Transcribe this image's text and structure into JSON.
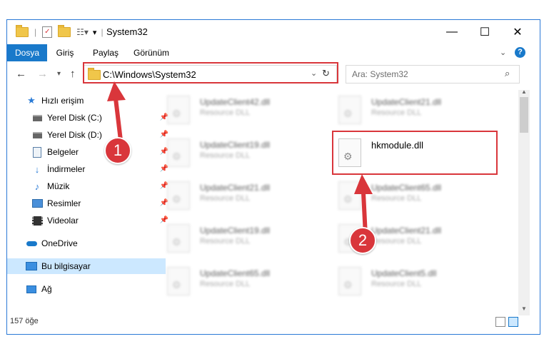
{
  "window": {
    "title": "System32"
  },
  "ribbon": {
    "tabs": [
      "Dosya",
      "Giriş",
      "Paylaş",
      "Görünüm"
    ],
    "help": "?"
  },
  "address": {
    "path": "C:\\Windows\\System32"
  },
  "search": {
    "placeholder": "Ara: System32"
  },
  "nav": {
    "items": [
      {
        "label": "Hızlı erişim",
        "icon": "star-icon"
      },
      {
        "label": "Yerel Disk (C:)",
        "icon": "drive-icon"
      },
      {
        "label": "Yerel Disk (D:)",
        "icon": "drive-icon"
      },
      {
        "label": "Belgeler",
        "icon": "documents-icon"
      },
      {
        "label": "İndirmeler",
        "icon": "download-icon"
      },
      {
        "label": "Müzik",
        "icon": "music-icon"
      },
      {
        "label": "Resimler",
        "icon": "pictures-icon"
      },
      {
        "label": "Videolar",
        "icon": "video-icon"
      },
      {
        "label": "OneDrive",
        "icon": "cloud-icon"
      },
      {
        "label": "Bu bilgisayar",
        "icon": "computer-icon"
      },
      {
        "label": "Ağ",
        "icon": "network-icon"
      }
    ]
  },
  "files": [
    {
      "name": "UpdateClient42.dll",
      "type": "Resource DLL"
    },
    {
      "name": "UpdateClient21.dll",
      "type": "Resource DLL"
    },
    {
      "name": "UpdateClient19.dll",
      "type": "Resource DLL"
    },
    {
      "name": "hkmodule.dll",
      "type": ""
    },
    {
      "name": "UpdateClient21.dll",
      "type": "Resource DLL"
    },
    {
      "name": "UpdateClient65.dll",
      "type": "Resource DLL"
    },
    {
      "name": "UpdateClient19.dll",
      "type": "Resource DLL"
    },
    {
      "name": "UpdateClient21.dll",
      "type": "Resource DLL"
    },
    {
      "name": "UpdateClient65.dll",
      "type": "Resource DLL"
    },
    {
      "name": "UpdateClient5.dll",
      "type": "Resource DLL"
    }
  ],
  "status": {
    "count": "157 öğe"
  },
  "annotations": {
    "badge1": "1",
    "badge2": "2"
  },
  "colors": {
    "accent": "#1979ca",
    "highlight": "#d9363b",
    "selection": "#cce8ff"
  }
}
